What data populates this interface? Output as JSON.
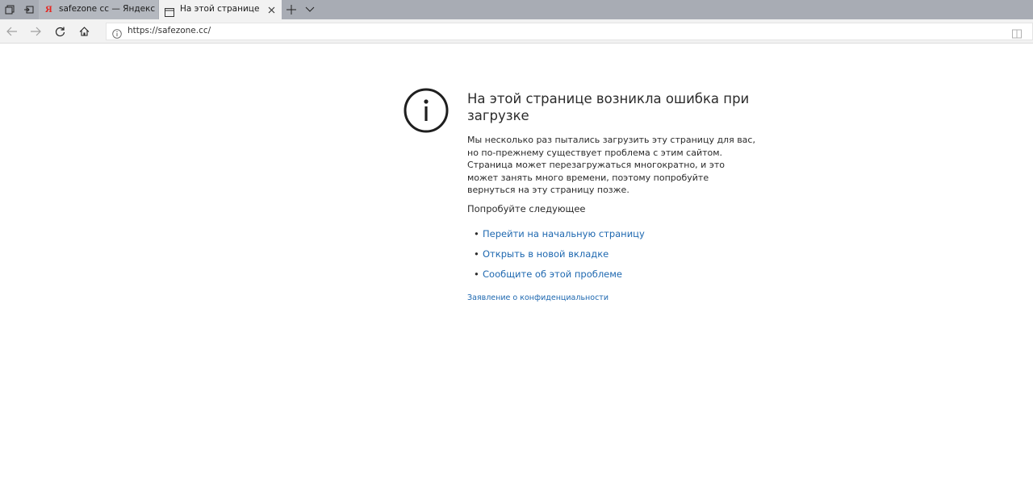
{
  "tabs": [
    {
      "title": "safezone cc — Яндекс: наш",
      "favicon": "yandex-icon",
      "active": false
    },
    {
      "title": "На этой странице возн",
      "favicon": "page-icon",
      "active": true
    }
  ],
  "toolbar": {
    "url": "https://safezone.cc/"
  },
  "error": {
    "title": "На этой странице возникла ошибка при загрузке",
    "description": "Мы несколько раз пытались загрузить эту страницу для вас, но по-прежнему существует проблема с этим сайтом. Страница может перезагружаться многократно, и это может занять много времени, поэтому попробуйте вернуться на эту страницу позже.",
    "try_heading": "Попробуйте следующее",
    "suggestions": [
      "Перейти на начальную страницу",
      "Открыть в новой вкладке",
      "Сообщите об этой проблеме"
    ],
    "privacy_link": "Заявление о конфиденциальности"
  },
  "colors": {
    "link": "#1e68b0",
    "tabbar": "#a8acb4",
    "yandex_red": "#e52620"
  }
}
